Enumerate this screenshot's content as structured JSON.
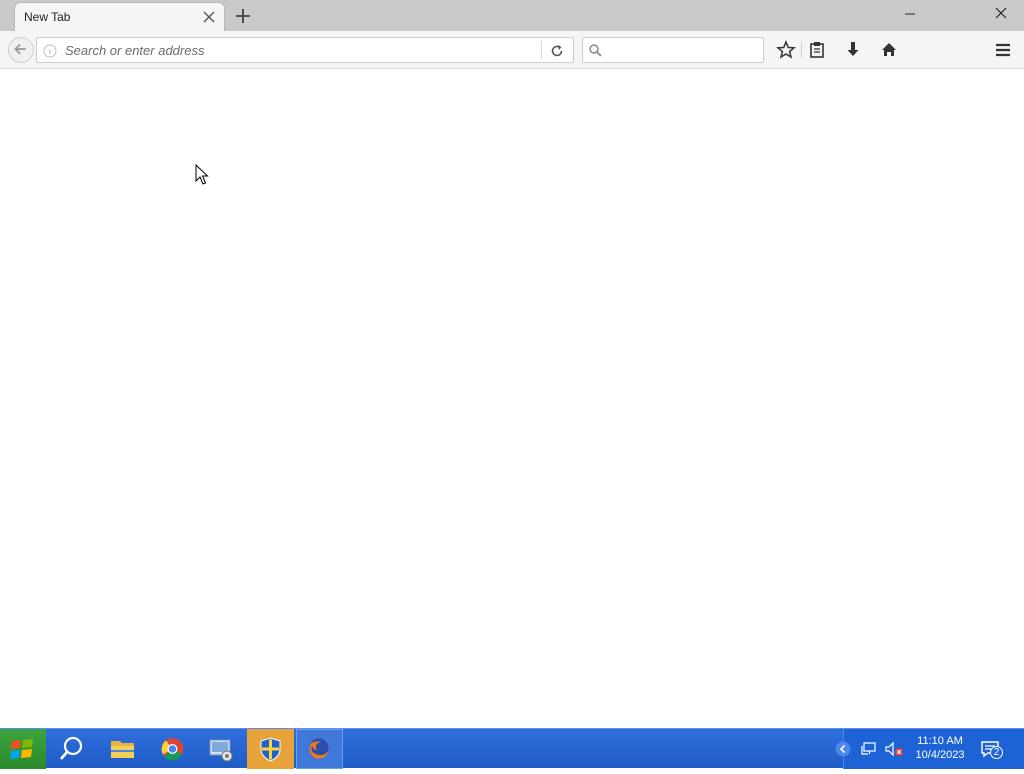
{
  "tab": {
    "title": "New Tab"
  },
  "urlbar": {
    "placeholder": "Search or enter address",
    "value": ""
  },
  "searchbar": {
    "placeholder": "",
    "value": ""
  },
  "icons": {
    "tab_close": "close-icon",
    "new_tab": "plus-icon",
    "minimize": "minimize-icon",
    "window_close": "close-icon",
    "back": "back-arrow-icon",
    "info": "info-icon",
    "reload": "reload-icon",
    "search": "search-icon",
    "bookmark": "star-icon",
    "library": "clipboard-icon",
    "downloads": "download-icon",
    "home": "home-icon",
    "menu": "hamburger-menu-icon",
    "start": "windows-logo-icon",
    "taskbar_search": "search-icon",
    "explorer": "folder-icon",
    "chrome": "chrome-icon",
    "control_panel": "control-panel-icon",
    "security": "shield-icon",
    "firefox": "firefox-icon",
    "tray_expand": "chevron-left-icon",
    "network": "network-icon",
    "volume": "volume-muted-icon",
    "notifications": "notification-icon"
  },
  "taskbar": {
    "clock": {
      "time": "11:10 AM",
      "date": "10/4/2023"
    },
    "notification_count": "2"
  },
  "colors": {
    "taskbar": "#1f5cc8",
    "start": "#2a8a2a",
    "titlebar": "#c9c9c9",
    "toolbar": "#f5f5f5"
  }
}
